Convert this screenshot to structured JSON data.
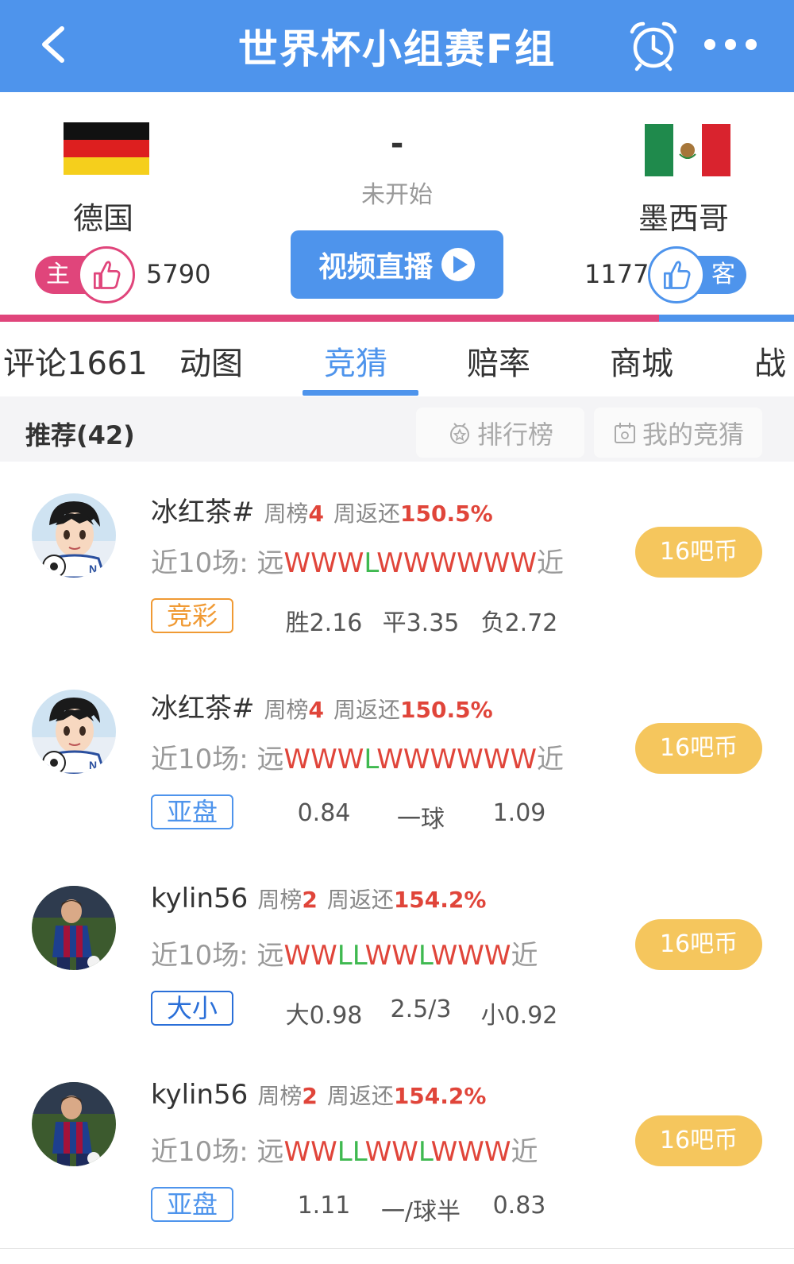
{
  "header": {
    "title": "世界杯小组赛F组"
  },
  "match": {
    "home": {
      "name": "德国",
      "vote_label": "主",
      "votes": "5790"
    },
    "away": {
      "name": "墨西哥",
      "vote_label": "客",
      "votes": "1177"
    },
    "score": "-",
    "status": "未开始",
    "video_label": "视频直播",
    "home_vote_share": 0.83
  },
  "tabs": [
    {
      "label": "评论1661"
    },
    {
      "label": "动图"
    },
    {
      "label": "竞猜",
      "active": true
    },
    {
      "label": "赔率"
    },
    {
      "label": "商城"
    },
    {
      "label": "战"
    }
  ],
  "subbar": {
    "recommend": "推荐(42)",
    "rank": "排行榜",
    "mine": "我的竞猜"
  },
  "items": [
    {
      "name": "冰红茶#",
      "rank_label": "周榜",
      "rank": "4",
      "return_label": "周返还",
      "return": "150.5%",
      "recent_prefix": "近10场: 远",
      "recent_suffix": "近",
      "results": [
        "W",
        "W",
        "W",
        "L",
        "W",
        "W",
        "W",
        "W",
        "W",
        "W"
      ],
      "tag": "竞彩",
      "tag_type": "jc",
      "odds": [
        "胜2.16",
        "平3.35",
        "负2.72"
      ],
      "price": "16吧币",
      "avatar": "cartoon"
    },
    {
      "name": "冰红茶#",
      "rank_label": "周榜",
      "rank": "4",
      "return_label": "周返还",
      "return": "150.5%",
      "recent_prefix": "近10场: 远",
      "recent_suffix": "近",
      "results": [
        "W",
        "W",
        "W",
        "L",
        "W",
        "W",
        "W",
        "W",
        "W",
        "W"
      ],
      "tag": "亚盘",
      "tag_type": "yp",
      "odds": [
        "0.84",
        "一球",
        "1.09"
      ],
      "price": "16吧币",
      "avatar": "cartoon"
    },
    {
      "name": "kylin56",
      "rank_label": "周榜",
      "rank": "2",
      "return_label": "周返还",
      "return": "154.2%",
      "recent_prefix": "近10场: 远",
      "recent_suffix": "近",
      "results": [
        "W",
        "W",
        "L",
        "L",
        "W",
        "W",
        "L",
        "W",
        "W",
        "W"
      ],
      "tag": "大小",
      "tag_type": "dx",
      "odds": [
        "大0.98",
        "2.5/3",
        "小0.92"
      ],
      "price": "16吧币",
      "avatar": "player"
    },
    {
      "name": "kylin56",
      "rank_label": "周榜",
      "rank": "2",
      "return_label": "周返还",
      "return": "154.2%",
      "recent_prefix": "近10场: 远",
      "recent_suffix": "近",
      "results": [
        "W",
        "W",
        "L",
        "L",
        "W",
        "W",
        "L",
        "W",
        "W",
        "W"
      ],
      "tag": "亚盘",
      "tag_type": "yp",
      "odds": [
        "1.11",
        "一/球半",
        "0.83"
      ],
      "price": "16吧币",
      "avatar": "player"
    }
  ],
  "colors": {
    "primary": "#4e94ec",
    "home": "#e0457b",
    "win": "#e0453a",
    "loss": "#3fb950",
    "price": "#f5c65d"
  }
}
